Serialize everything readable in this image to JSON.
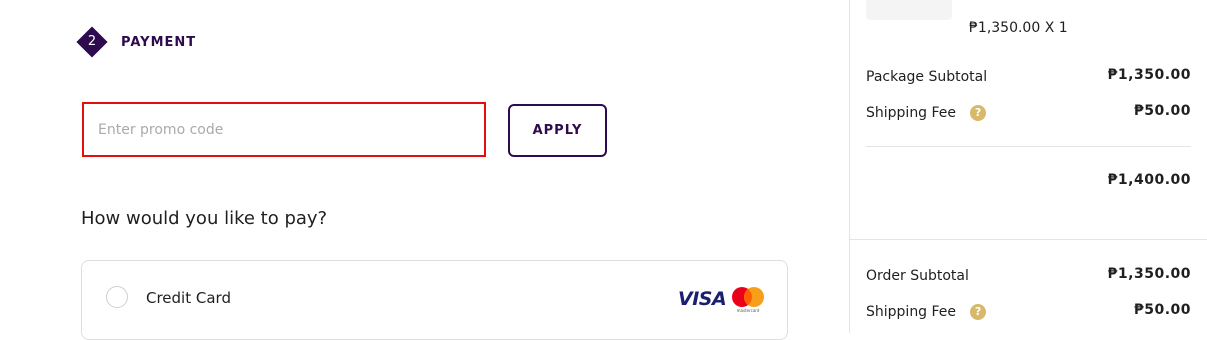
{
  "step": {
    "number": "2",
    "title": "PAYMENT"
  },
  "promo": {
    "placeholder": "Enter promo code",
    "apply_label": "APPLY"
  },
  "payment": {
    "question": "How would you like to pay?",
    "options": [
      {
        "label": "Credit Card",
        "brand_visa": "VISA",
        "brand_mastercard": "mastercard"
      }
    ]
  },
  "summary": {
    "item_price": "₱1,350.00 X 1",
    "package": {
      "subtotal_label": "Package Subtotal",
      "subtotal_value": "₱1,350.00",
      "shipping_label": "Shipping Fee",
      "shipping_value": "₱50.00",
      "total_value": "₱1,400.00"
    },
    "order": {
      "subtotal_label": "Order Subtotal",
      "subtotal_value": "₱1,350.00",
      "shipping_label": "Shipping Fee",
      "shipping_value": "₱50.00"
    },
    "help_glyph": "?"
  },
  "colors": {
    "brand": "#2e0a4f",
    "highlight": "#e60d0d",
    "help": "#d8b96a",
    "visa": "#1a1f71"
  }
}
